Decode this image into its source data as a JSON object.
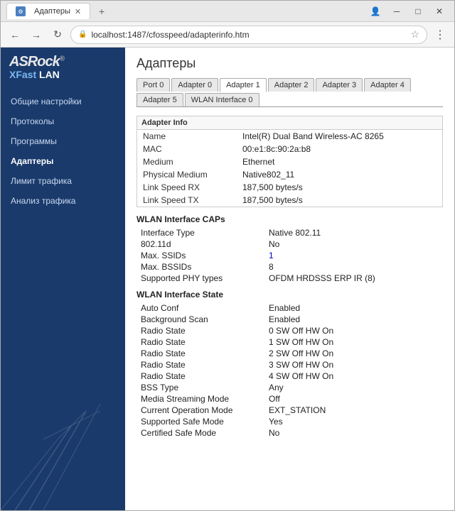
{
  "browser": {
    "title": "Адаптеры",
    "url": "localhost:1487/cfosspeed/adapterinfo.htm",
    "back_disabled": false,
    "forward_disabled": true
  },
  "sidebar": {
    "logo_line1": "ASRock",
    "logo_line2": "XFast LAN",
    "menu_items": [
      {
        "label": "Общие настройки",
        "active": false
      },
      {
        "label": "Протоколы",
        "active": false
      },
      {
        "label": "Программы",
        "active": false
      },
      {
        "label": "Адаптеры",
        "active": true
      },
      {
        "label": "Лимит трафика",
        "active": false
      },
      {
        "label": "Анализ трафика",
        "active": false
      }
    ]
  },
  "page": {
    "title": "Адаптеры",
    "tabs": [
      {
        "label": "Port 0",
        "active": false
      },
      {
        "label": "Adapter 0",
        "active": false
      },
      {
        "label": "Adapter 1",
        "active": true
      },
      {
        "label": "Adapter 2",
        "active": false
      },
      {
        "label": "Adapter 3",
        "active": false
      },
      {
        "label": "Adapter 4",
        "active": false
      },
      {
        "label": "Adapter 5",
        "active": false
      },
      {
        "label": "WLAN Interface 0",
        "active": false
      }
    ],
    "adapter_info": {
      "section_title": "Adapter Info",
      "rows": [
        {
          "label": "Name",
          "value": "Intel(R) Dual Band Wireless-AC 8265"
        },
        {
          "label": "MAC",
          "value": "00:e1:8c:90:2a:b8"
        },
        {
          "label": "Medium",
          "value": "Ethernet"
        },
        {
          "label": "Physical Medium",
          "value": "Native802_11"
        },
        {
          "label": "Link Speed RX",
          "value": "187,500 bytes/s"
        },
        {
          "label": "Link Speed TX",
          "value": "187,500 bytes/s"
        }
      ]
    },
    "wlan_caps": {
      "header": "WLAN Interface CAPs",
      "rows": [
        {
          "label": "Interface Type",
          "value": "Native 802.11"
        },
        {
          "label": "802.11d",
          "value": "No"
        },
        {
          "label": "Max. SSIDs",
          "value": "1",
          "highlight": true
        },
        {
          "label": "Max. BSSIDs",
          "value": "8"
        },
        {
          "label": "Supported PHY types",
          "value": "OFDM HRDSSS ERP IR (8)"
        }
      ]
    },
    "wlan_state": {
      "header": "WLAN Interface State",
      "rows": [
        {
          "label": "Auto Conf",
          "value": "Enabled"
        },
        {
          "label": "Background Scan",
          "value": "Enabled"
        },
        {
          "label": "Radio State",
          "value": "0 SW Off HW On"
        },
        {
          "label": "Radio State",
          "value": "1 SW Off HW On"
        },
        {
          "label": "Radio State",
          "value": "2 SW Off HW On"
        },
        {
          "label": "Radio State",
          "value": "3 SW Off HW On"
        },
        {
          "label": "Radio State",
          "value": "4 SW Off HW On"
        },
        {
          "label": "BSS Type",
          "value": "Any"
        },
        {
          "label": "Media Streaming Mode",
          "value": "Off"
        },
        {
          "label": "Current Operation Mode",
          "value": "EXT_STATION"
        },
        {
          "label": "Supported Safe Mode",
          "value": "Yes"
        },
        {
          "label": "Certified Safe Mode",
          "value": "No"
        }
      ]
    }
  }
}
